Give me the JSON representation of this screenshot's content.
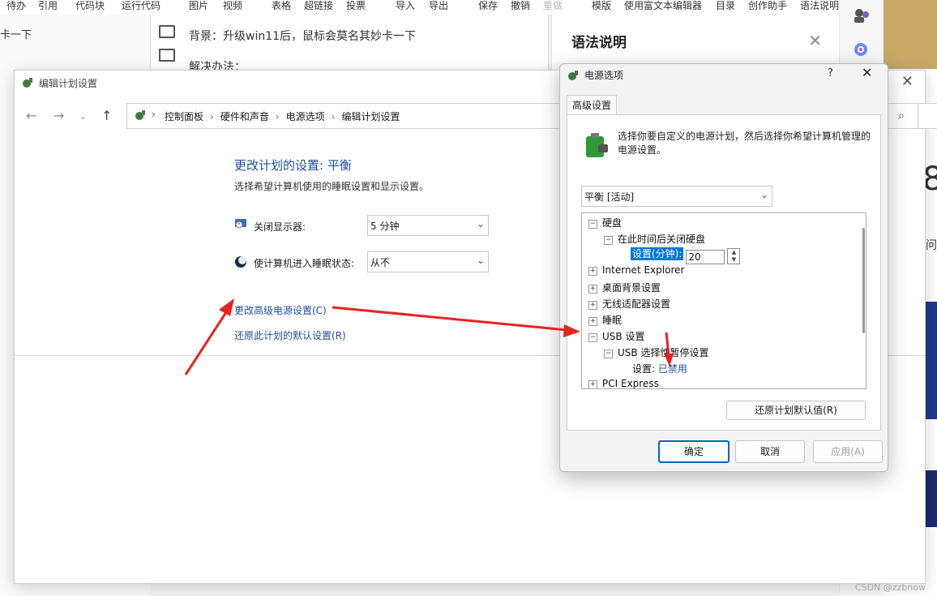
{
  "editor": {
    "toolbar": [
      "待办",
      "引用",
      "代码块",
      "运行代码",
      "图片",
      "视频",
      "表格",
      "超链接",
      "投票",
      "导入",
      "导出",
      "保存",
      "撤销",
      "重做",
      "模版",
      "使用富文本编辑器",
      "目录",
      "创作助手",
      "语法说明"
    ],
    "left_text": "卡一下",
    "line1": "背景：升级win11后，鼠标会莫名其妙卡一下",
    "line2": "解决办法：",
    "grammar_title": "语法说明",
    "close_glyph": "✕"
  },
  "plan_window": {
    "title": "编辑计划设置",
    "breadcrumb": [
      "控制面板",
      "硬件和声音",
      "电源选项",
      "编辑计划设置"
    ],
    "heading": "更改计划的设置: 平衡",
    "subheading": "选择希望计算机使用的睡眠设置和显示设置。",
    "settings": [
      {
        "label": "关闭显示器:",
        "value": "5 分钟"
      },
      {
        "label": "使计算机进入睡眠状态:",
        "value": "从不"
      }
    ],
    "link_advanced": "更改高级电源设置(C)",
    "link_restore": "还原此计划的默认设置(R)"
  },
  "power_dialog": {
    "title": "电源选项",
    "help": "?",
    "tab": "高级设置",
    "description": "选择你要自定义的电源计划，然后选择你希望计算机管理的电源设置。",
    "plan_select": "平衡 [活动]",
    "tree": {
      "disk": "硬盘",
      "disk_off": "在此时间后关闭硬盘",
      "disk_setting_label": "设置(分钟):",
      "disk_setting_value": "20",
      "ie": "Internet Explorer",
      "desktop_bg": "桌面背景设置",
      "wireless": "无线适配器设置",
      "sleep": "睡眠",
      "usb": "USB 设置",
      "usb_suspend": "USB 选择性暂停设置",
      "usb_setting_label": "设置:",
      "usb_setting_value": "已禁用",
      "pci": "PCI Express"
    },
    "restore_defaults": "还原计划默认值(R)",
    "ok": "确定",
    "cancel": "取消",
    "apply": "应用(A)"
  },
  "watermark": "CSDN @zzbnow",
  "colors": {
    "arrow": "#e8231f",
    "link": "#1f4e9c",
    "accent": "#0078d7"
  }
}
